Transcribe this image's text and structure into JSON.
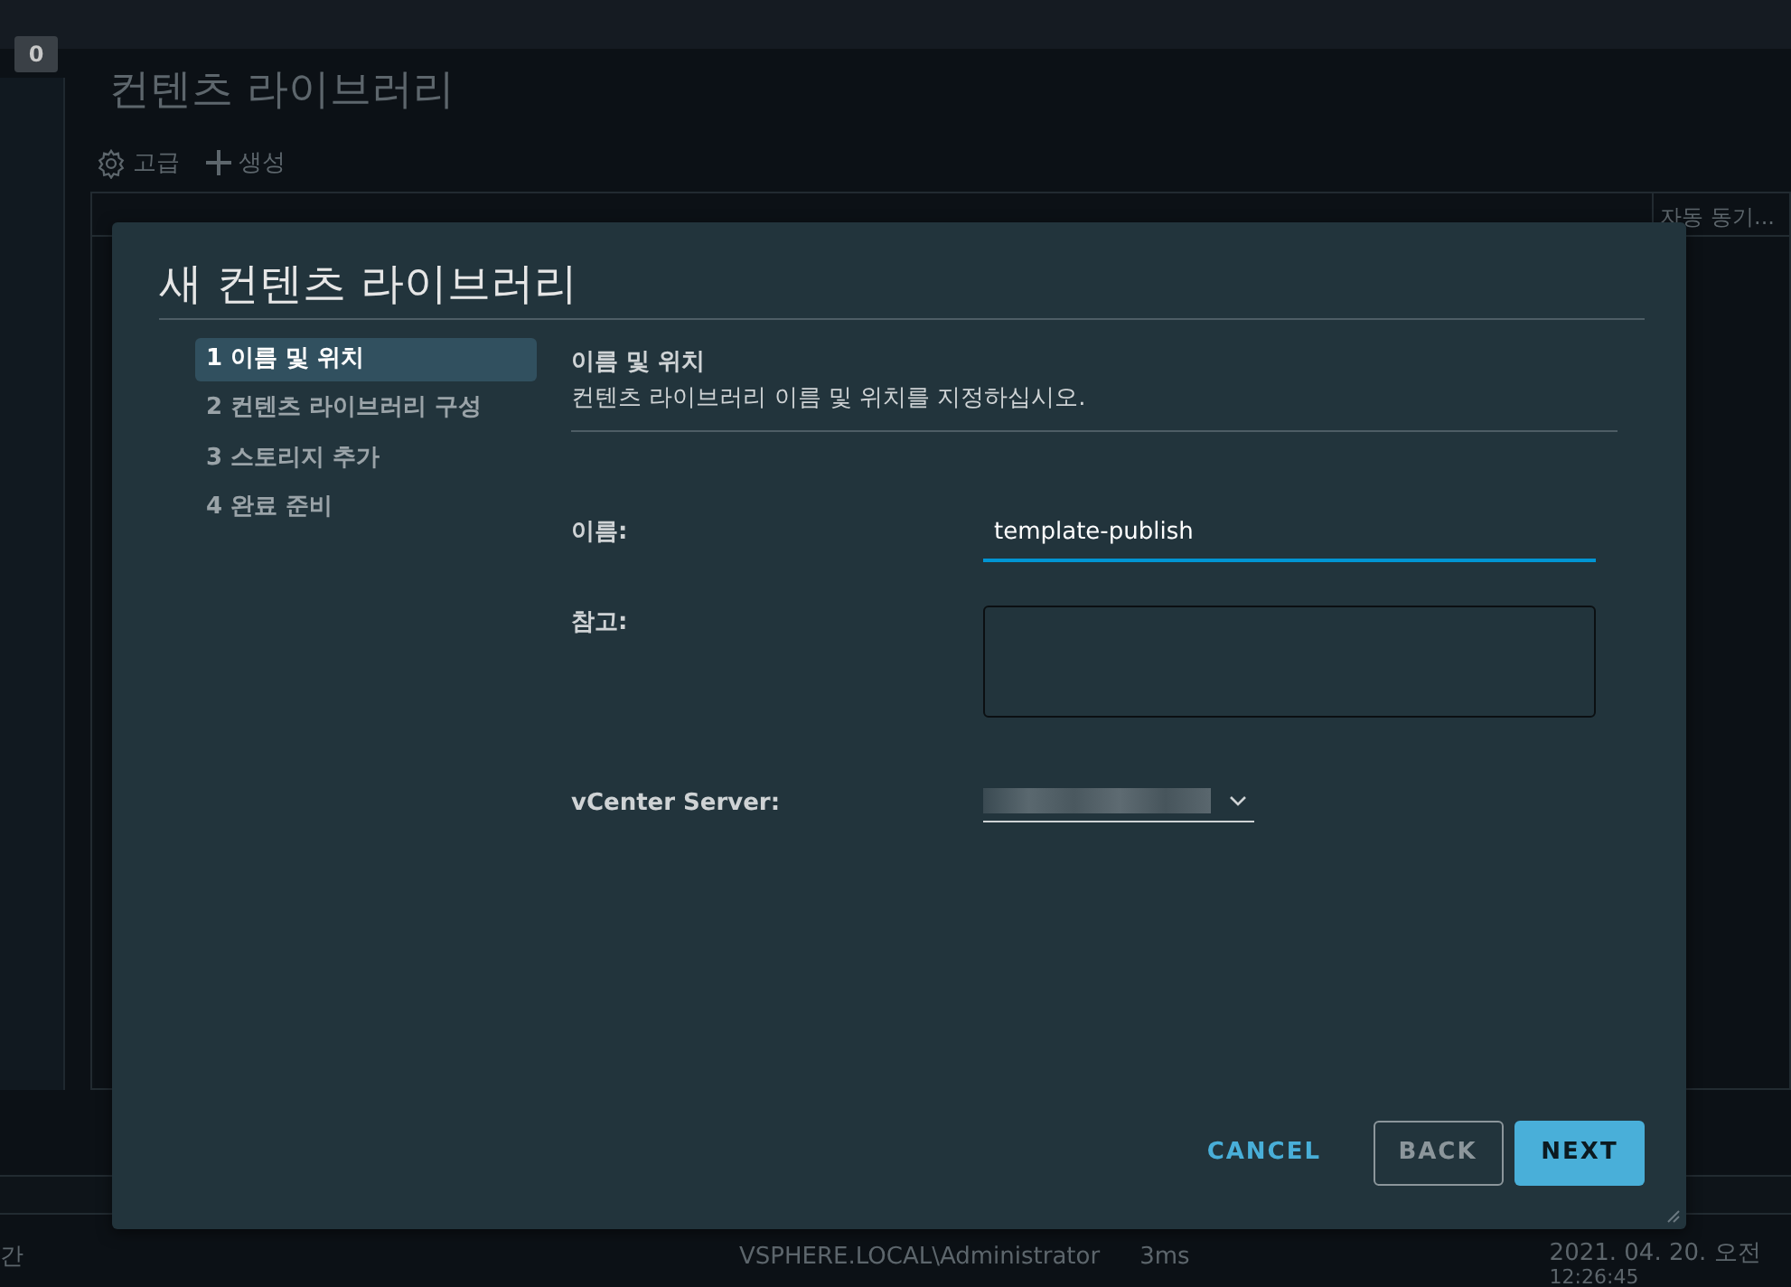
{
  "background": {
    "badge": "0",
    "title": "컨텐츠 라이브러리",
    "toolbar": [
      {
        "kind": "settings",
        "label": "고급"
      },
      {
        "kind": "create",
        "label": "생성"
      }
    ],
    "table": {
      "columns": [
        "자동 동기..."
      ]
    },
    "status": {
      "column_1": "간",
      "user": "VSPHERE.LOCAL\\Administrator",
      "latency": "3ms",
      "date": "2021. 04. 20. 오전",
      "time": "12:26:45"
    }
  },
  "dialog": {
    "title": "새 컨텐츠 라이브러리",
    "steps": [
      {
        "label": "1 이름 및 위치",
        "selected": true
      },
      {
        "label": "2 컨텐츠 라이브러리 구성",
        "selected": false
      },
      {
        "label": "3 스토리지 추가",
        "selected": false
      },
      {
        "label": "4 완료 준비",
        "selected": false
      }
    ],
    "section_title": "이름 및 위치",
    "description": "컨텐츠 라이브러리 이름 및 위치를 지정하십시오.",
    "fields": [
      {
        "kind": "text",
        "label": "이름:",
        "value": "template-publish",
        "focused": true
      },
      {
        "kind": "textarea",
        "label": "참고:"
      },
      {
        "kind": "select",
        "label": "vCenter Server:"
      }
    ],
    "buttons": [
      {
        "kind": "link",
        "label": "CANCEL"
      },
      {
        "kind": "outline",
        "label": "BACK"
      },
      {
        "kind": "primary",
        "label": "NEXT"
      }
    ]
  }
}
